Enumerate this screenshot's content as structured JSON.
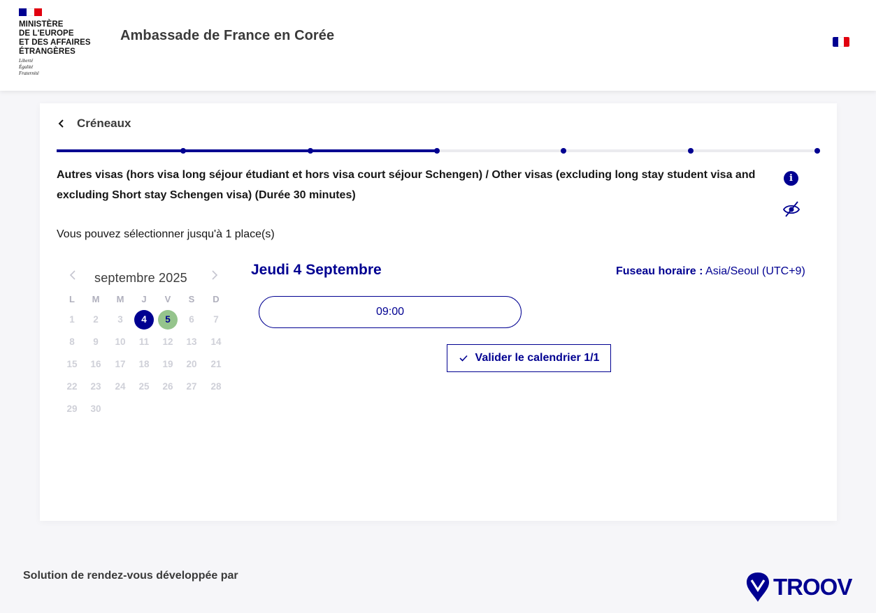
{
  "header": {
    "logo_lines": [
      "MINISTÈRE",
      "DE L'EUROPE",
      "ET DES AFFAIRES",
      "ÉTRANGÈRES"
    ],
    "motto_lines": [
      "Liberté",
      "Égalité",
      "Fraternité"
    ],
    "site_title": "Ambassade de France en Corée",
    "flag_colors": [
      "#000091",
      "#ffffff",
      "#e1000f"
    ]
  },
  "card": {
    "back_label": "Créneaux",
    "stepper": {
      "total_steps": 7,
      "completed_steps": 4,
      "active_color": "#000091"
    },
    "service_title": "Autres visas (hors visa long séjour étudiant et hors visa court séjour Schengen) / Other visas (excluding long stay student visa and excluding Short stay Schengen visa) (Durée 30 minutes)",
    "info_icon": "info-icon",
    "visibility_icon": "eye-off-icon",
    "seats_text": "Vous pouvez sélectionner jusqu'à 1 place(s)",
    "calendar": {
      "month_label": "septembre 2025",
      "prev_icon": "chevron-left-icon",
      "next_icon": "chevron-right-icon",
      "weekdays": [
        "L",
        "M",
        "M",
        "J",
        "V",
        "S",
        "D"
      ],
      "days": [
        [
          "1",
          "2",
          "3",
          "4",
          "5",
          "6",
          "7"
        ],
        [
          "8",
          "9",
          "10",
          "11",
          "12",
          "13",
          "14"
        ],
        [
          "15",
          "16",
          "17",
          "18",
          "19",
          "20",
          "21"
        ],
        [
          "22",
          "23",
          "24",
          "25",
          "26",
          "27",
          "28"
        ],
        [
          "29",
          "30"
        ]
      ],
      "selected_day": "4",
      "available_days": [
        "5"
      ]
    },
    "day_title": "Jeudi 4 Septembre",
    "timezone_label": "Fuseau horaire :",
    "timezone_value": "Asia/Seoul (UTC+9)",
    "slots": [
      "09:00"
    ],
    "validate_label": "Valider le calendrier 1/1"
  },
  "footer": {
    "text": "Solution de rendez-vous développée par",
    "brand": "TROOV"
  }
}
